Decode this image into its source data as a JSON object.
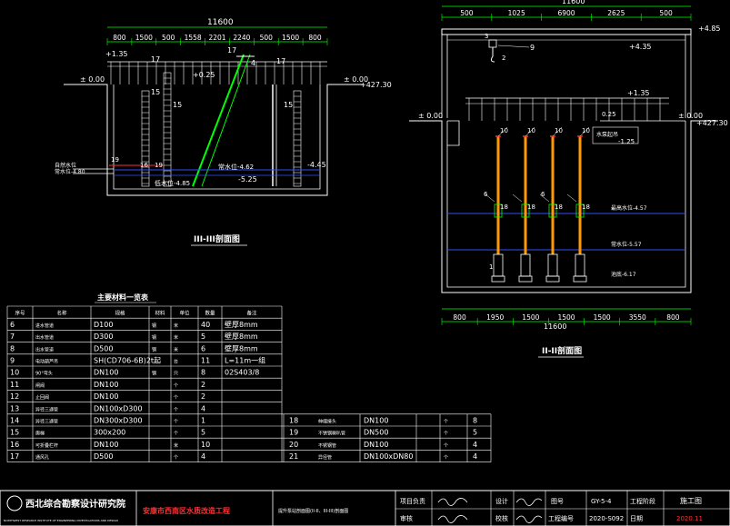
{
  "left_section": {
    "title": "III-III剖面图",
    "total_dim": "11600",
    "dims": [
      "800",
      "1500",
      "500",
      "1558",
      "2201",
      "2240",
      "500",
      "1500",
      "800"
    ],
    "levels": {
      "top_left": "+1.35",
      "ground_left": "± 0.00",
      "ground_right": "± 0.00",
      "abs_right": "+427.30",
      "mid": "+0.25",
      "water_right": "-4.45",
      "water_mid": "常水位-4.62",
      "water_low": "-5.25",
      "bottom": "低水位-4.85",
      "left_note1": "自然水位",
      "left_note2": "常水位-4.80"
    },
    "callouts": [
      "17",
      "17",
      "17",
      "4",
      "15",
      "15",
      "15",
      "19",
      "19",
      "16"
    ]
  },
  "right_section": {
    "title": "II-II剖面图",
    "top_dims": [
      "500",
      "1025",
      "6900",
      "2625",
      "500"
    ],
    "top_total": "11600",
    "bottom_dims": [
      "800",
      "1950",
      "1500",
      "1500",
      "1500",
      "3550",
      "800"
    ],
    "bottom_total": "11600",
    "levels": {
      "roof": "+4.85",
      "crane": "+4.35",
      "rail": "+1.35",
      "ground_left": "± 0.00",
      "ground_right": "± 0.00",
      "abs": "+427.30",
      "inner": "0.25",
      "inner2": "-1.25",
      "inner_note": "水泵起吊",
      "w1": "最高水位-4.57",
      "w2": "常水位-5.57",
      "w3": "池底-6.17"
    },
    "callouts": [
      "3",
      "2",
      "9",
      "10",
      "10",
      "10",
      "10",
      "18",
      "18",
      "18",
      "18",
      "6",
      "6",
      "1",
      "1",
      "1",
      "1",
      "1"
    ]
  },
  "table": {
    "title": "主要材料一览表",
    "headers": [
      "序号",
      "名称",
      "规格",
      "材料",
      "单位",
      "数量",
      "备注"
    ],
    "rows": [
      [
        "6",
        "进水管道",
        "D100",
        "钢",
        "米",
        "40",
        "壁厚8mm"
      ],
      [
        "7",
        "出水管道",
        "D300",
        "钢",
        "米",
        "5",
        "壁厚8mm"
      ],
      [
        "8",
        "出水管道",
        "D500",
        "钢",
        "米",
        "6",
        "壁厚8mm"
      ],
      [
        "9",
        "电动葫芦吊",
        "SH(CD706-6B)2t起",
        "",
        "台",
        "11",
        "L=11m一组"
      ],
      [
        "10",
        "90°弯头",
        "DN100",
        "钢",
        "只",
        "8",
        "02S403/8"
      ],
      [
        "11",
        "闸阀",
        "DN100",
        "",
        "个",
        "2",
        ""
      ],
      [
        "12",
        "止回阀",
        "DN100",
        "",
        "个",
        "2",
        ""
      ],
      [
        "13",
        "异径三通管",
        "DN100xD300",
        "",
        "个",
        "4",
        ""
      ],
      [
        "14",
        "异径三通管",
        "DN300xD300",
        "",
        "个",
        "1",
        ""
      ],
      [
        "15",
        "爬梯",
        "300x200",
        "",
        "个",
        "5",
        ""
      ],
      [
        "16",
        "可折叠栏杆",
        "DN100",
        "",
        "米",
        "10",
        ""
      ],
      [
        "17",
        "通风孔",
        "D500",
        "",
        "个",
        "4",
        ""
      ]
    ],
    "rows2": [
      [
        "18",
        "伸缩接头",
        "DN100",
        "",
        "个",
        "8"
      ],
      [
        "19",
        "不锈钢喇叭管",
        "DN500",
        "",
        "个",
        "5"
      ],
      [
        "20",
        "不锈钢管",
        "DN100",
        "",
        "个",
        "4"
      ],
      [
        "21",
        "异径管",
        "DN100xDN80",
        "",
        "个",
        "4"
      ]
    ]
  },
  "titleblock": {
    "institute": "西北综合勘察设计研究院",
    "institute_en": "NORTHWEST RESEARCH INSTITUTE OF ENGINEERING INVESTIGATIONS AND DESIGN",
    "project": "安康市西南区水质改造工程",
    "drawing": "提升泵站剖面图(II-II、III-III)剖面图",
    "labels": [
      "项目负责",
      "审核",
      "设计",
      "校核",
      "图号",
      "工程编号",
      "工程阶段",
      "日期"
    ],
    "values": {
      "drawing_no": "GY-5-4",
      "project_no": "2020-S092",
      "stage": "施工图",
      "date": "2020.11"
    }
  },
  "colors": {
    "line": "#ffffff",
    "dim": "#00ff00",
    "text": "#ffffff",
    "yellow": "#ffff00",
    "red": "#ff3030",
    "blue": "#3050ff",
    "orange": "#ff9900",
    "magenta": "#ff00ff",
    "cyan": "#00ffff"
  }
}
